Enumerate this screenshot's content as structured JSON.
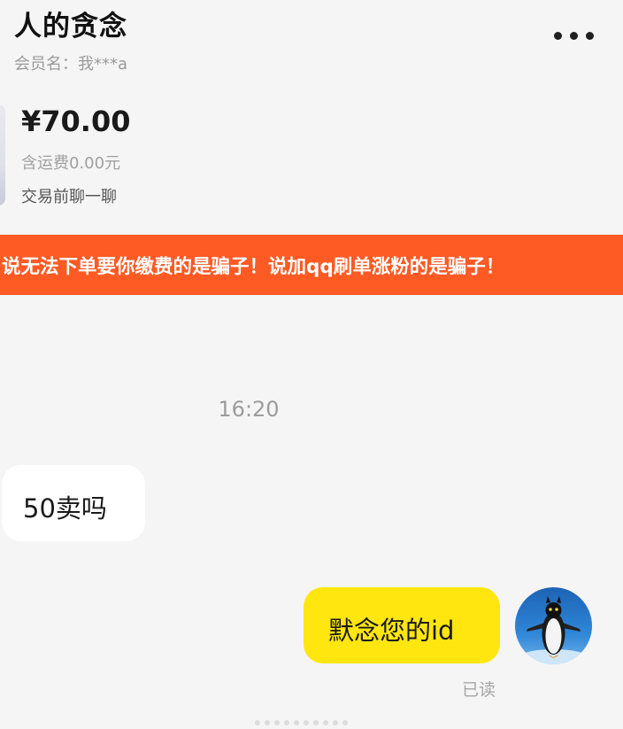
{
  "header": {
    "title": "人的贪念",
    "subtitle": "会员名：我***a"
  },
  "product": {
    "price": "¥70.00",
    "shipping": "含运费0.00元",
    "chat_link": "交易前聊一聊"
  },
  "warning": {
    "text": "说无法下单要你缴费的是骗子！说加qq刷单涨粉的是骗子！",
    "color": "#fd5a24"
  },
  "chat": {
    "timestamp": "16:20",
    "messages": [
      {
        "side": "left",
        "text": "50卖吗"
      },
      {
        "side": "right",
        "text": "默念您的id"
      }
    ],
    "read_status": "已读"
  },
  "icons": {
    "more": "more-dots-icon",
    "avatar": "penguin-avatar"
  },
  "colors": {
    "accent_bubble": "#ffe60f",
    "incoming_bubble": "#ffffff",
    "background": "#f5f5f5"
  }
}
